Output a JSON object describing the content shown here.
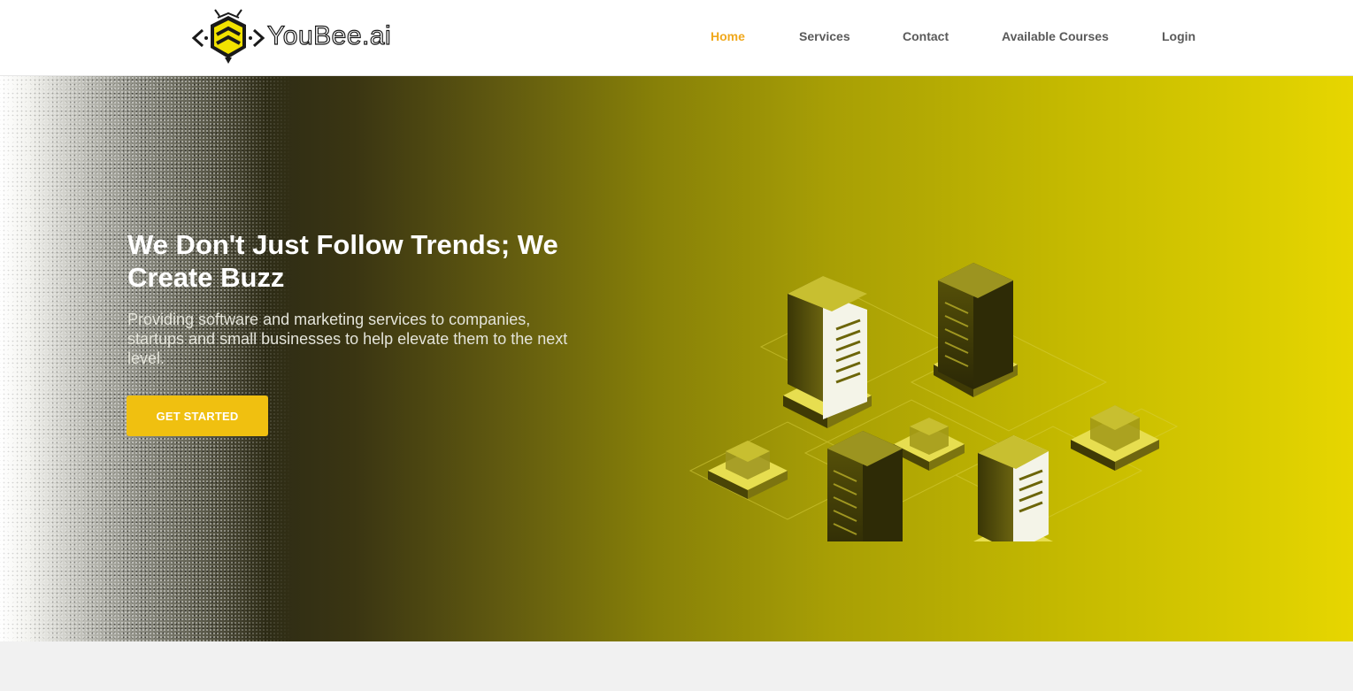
{
  "brand": {
    "name": "YouBee.ai",
    "logo_icon": "bee-logo-icon",
    "colors": {
      "accent": "#f0a81c",
      "button": "#f0c010",
      "hero_dark": "#2e2c16",
      "hero_yellow": "#e7d600"
    }
  },
  "nav": {
    "items": [
      {
        "label": "Home",
        "active": true
      },
      {
        "label": "Services",
        "active": false
      },
      {
        "label": "Contact",
        "active": false
      },
      {
        "label": "Available Courses",
        "active": false
      },
      {
        "label": "Login",
        "active": false
      }
    ]
  },
  "hero": {
    "title": "We Don't Just Follow Trends; We Create Buzz",
    "subtitle": "Providing software and marketing services to companies, startups and small businesses to help elevate them to the next level.",
    "cta_label": "GET STARTED",
    "illustration_icon": "isometric-servers-illustration"
  }
}
